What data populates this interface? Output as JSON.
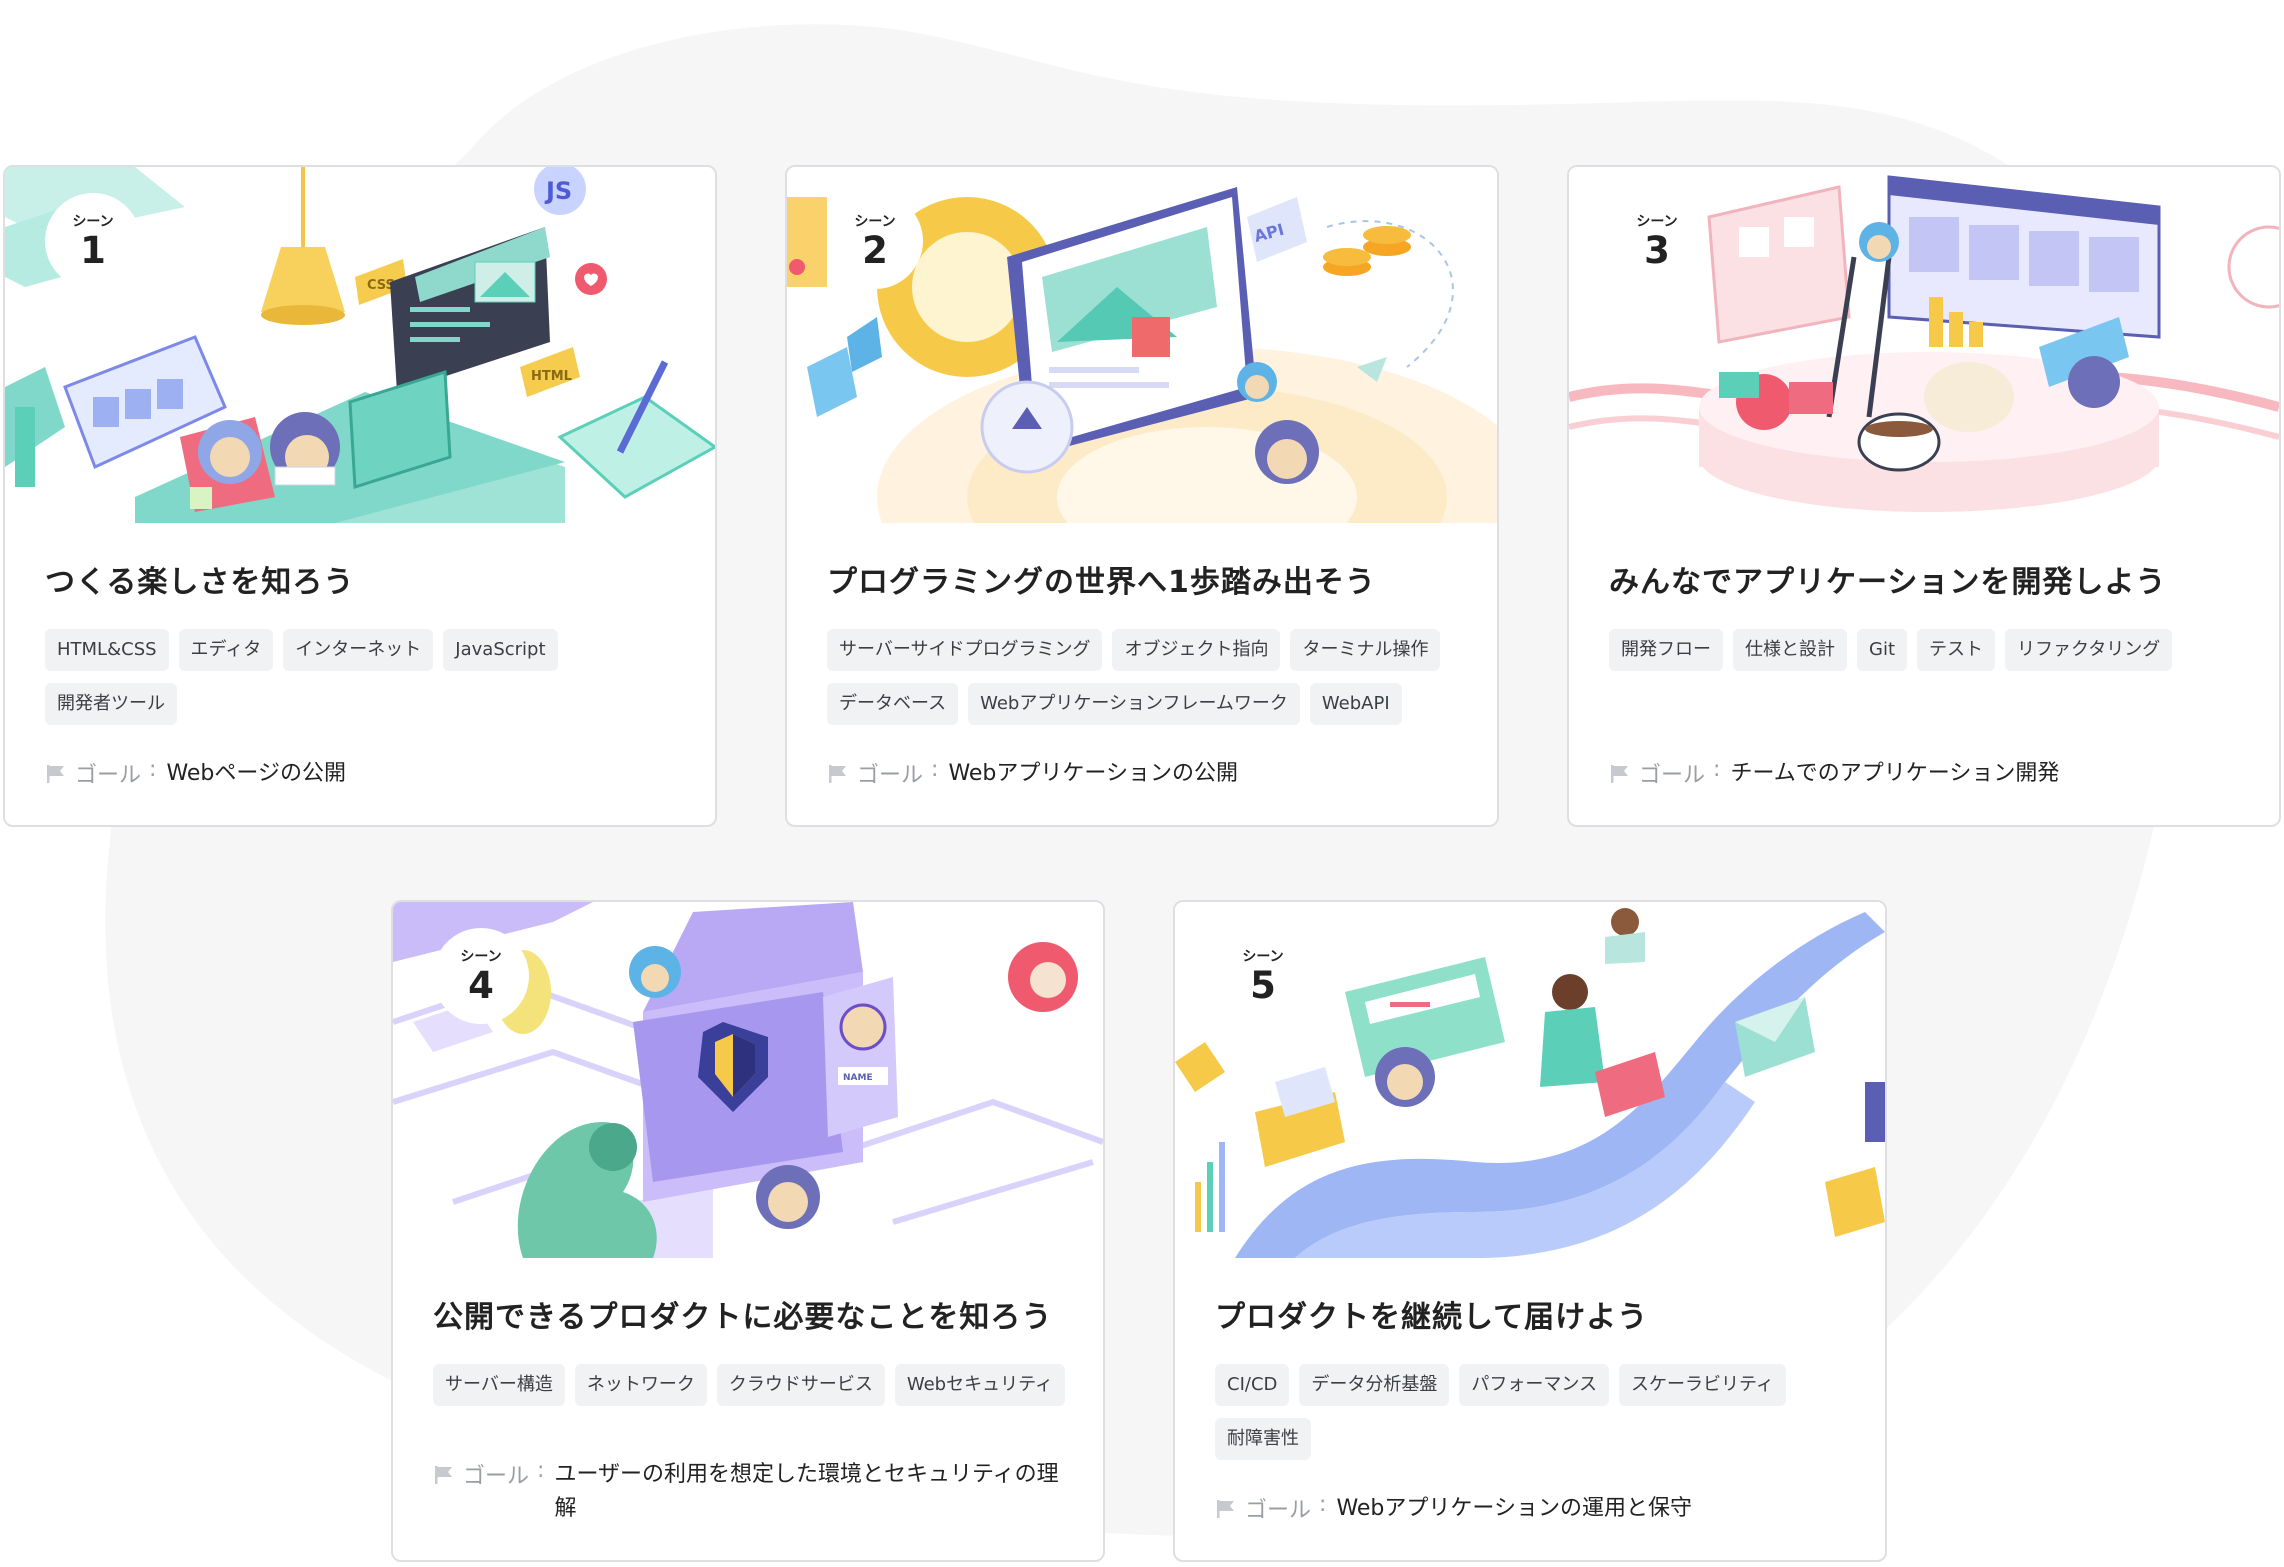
{
  "scene_label": "シーン",
  "goal_label": "ゴール",
  "goal_separator": ":",
  "cards": [
    {
      "number": "1",
      "title": "つくる楽しさを知ろう",
      "tags": [
        "HTML&CSS",
        "エディタ",
        "インターネット",
        "JavaScript",
        "開発者ツール"
      ],
      "goal": "Webページの公開",
      "illustration_labels": [
        "CSS",
        "HTML",
        "JS"
      ],
      "theme_color": "#7fd8c9"
    },
    {
      "number": "2",
      "title": "プログラミングの世界へ1歩踏み出そう",
      "tags": [
        "サーバーサイドプログラミング",
        "オブジェクト指向",
        "ターミナル操作",
        "データベース",
        "Webアプリケーションフレームワーク",
        "WebAPI"
      ],
      "goal": "Webアプリケーションの公開",
      "illustration_labels": [
        "API"
      ],
      "theme_color": "#fdd78a"
    },
    {
      "number": "3",
      "title": "みんなでアプリケーションを開発しよう",
      "tags": [
        "開発フロー",
        "仕様と設計",
        "Git",
        "テスト",
        "リファクタリング"
      ],
      "goal": "チームでのアプリケーション開発",
      "illustration_labels": [],
      "theme_color": "#f7b8bf"
    },
    {
      "number": "4",
      "title": "公開できるプロダクトに必要なことを知ろう",
      "tags": [
        "サーバー構造",
        "ネットワーク",
        "クラウドサービス",
        "Webセキュリティ"
      ],
      "goal": "ユーザーの利用を想定した環境とセキュリティの理解",
      "illustration_labels": [
        "NAME"
      ],
      "theme_color": "#b9a8f3"
    },
    {
      "number": "5",
      "title": "プロダクトを継続して届けよう",
      "tags": [
        "CI/CD",
        "データ分析基盤",
        "パフォーマンス",
        "スケーラビリティ",
        "耐障害性"
      ],
      "goal": "Webアプリケーションの運用と保守",
      "illustration_labels": [],
      "theme_color": "#9fb6f5"
    }
  ]
}
